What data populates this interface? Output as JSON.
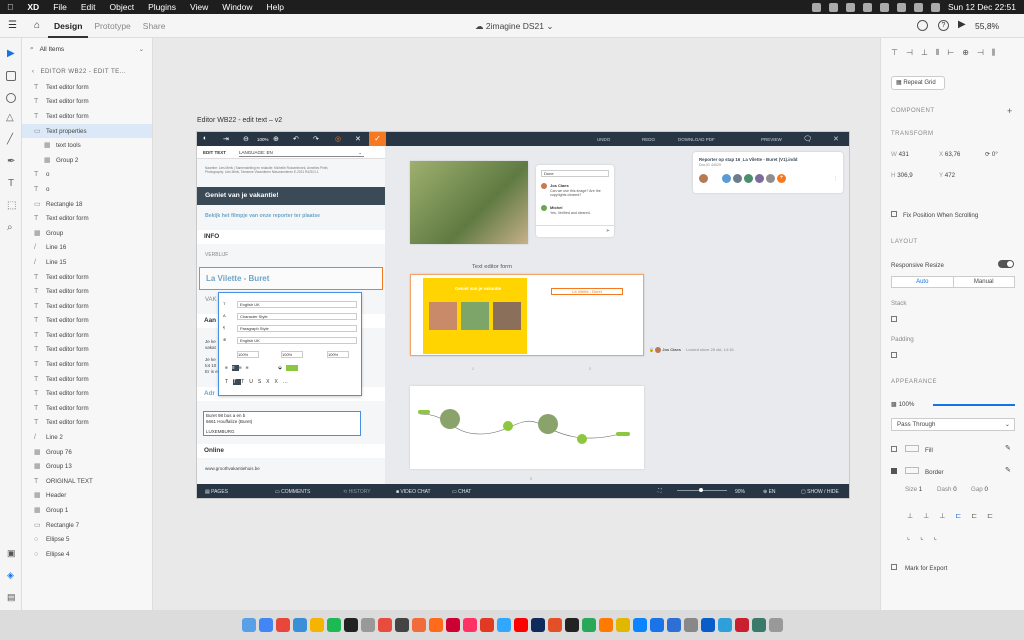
{
  "menubar": {
    "apple": "",
    "app": "XD",
    "items": [
      "File",
      "Edit",
      "Object",
      "Plugins",
      "View",
      "Window",
      "Help"
    ],
    "datetime": "Sun 12 Dec  22:51"
  },
  "xdbar": {
    "tabs": [
      "Design",
      "Prototype",
      "Share"
    ],
    "doc_title": "2imagine DS21",
    "zoom": "55,8%"
  },
  "layers": {
    "filter": "All Items",
    "back_label": "EDITOR WB22 - EDIT TE...",
    "rows": [
      {
        "l": "Text editor form",
        "ic": "T"
      },
      {
        "l": "Text editor form",
        "ic": "T"
      },
      {
        "l": "Text editor form",
        "ic": "T"
      },
      {
        "l": "Text properties",
        "ic": "▭",
        "sel": true
      },
      {
        "l": "text tools",
        "ic": "▦",
        "ind": true
      },
      {
        "l": "Group 2",
        "ic": "▦",
        "ind": true
      },
      {
        "l": "o",
        "ic": "T"
      },
      {
        "l": "o",
        "ic": "T"
      },
      {
        "l": "Rectangle 18",
        "ic": "▭"
      },
      {
        "l": "Text editor form",
        "ic": "T"
      },
      {
        "l": "Group",
        "ic": "▦"
      },
      {
        "l": "Line 16",
        "ic": "/"
      },
      {
        "l": "Line 15",
        "ic": "/"
      },
      {
        "l": "Text editor form",
        "ic": "T"
      },
      {
        "l": "Text editor form",
        "ic": "T"
      },
      {
        "l": "Text editor form",
        "ic": "T"
      },
      {
        "l": "Text editor form",
        "ic": "T"
      },
      {
        "l": "Text editor form",
        "ic": "T"
      },
      {
        "l": "Text editor form",
        "ic": "T"
      },
      {
        "l": "Text editor form",
        "ic": "T"
      },
      {
        "l": "Text editor form",
        "ic": "T"
      },
      {
        "l": "Text editor form",
        "ic": "T"
      },
      {
        "l": "Text editor form",
        "ic": "T"
      },
      {
        "l": "Text editor form",
        "ic": "T"
      },
      {
        "l": "Line 2",
        "ic": "/"
      },
      {
        "l": "Group 76",
        "ic": "▦"
      },
      {
        "l": "Group 13",
        "ic": "▦"
      },
      {
        "l": "ORIGINAL TEXT",
        "ic": "T"
      },
      {
        "l": "Header",
        "ic": "▦"
      },
      {
        "l": "Group 1",
        "ic": "▦"
      },
      {
        "l": "Rectangle 7",
        "ic": "▭"
      },
      {
        "l": "Ellipse 5",
        "ic": "○"
      },
      {
        "l": "Ellipse 4",
        "ic": "○"
      }
    ]
  },
  "canvas": {
    "artboard_title": "Editor WB22 - edit text – v2",
    "frame_label": "Text editor form"
  },
  "editor": {
    "top_zoom": "100%",
    "top_btns": [
      "UNDO",
      "REDO",
      "DOWNLOAD PDF",
      "PREVIEW"
    ],
    "edit_text_tab": "EDIT TEXT",
    "language": "LANGUAGE: EN",
    "credits": "Naamhe: Lies Melis | Samenstelling en redactie: Michelle Rossenbroek, Annelies Pirlet, Photography: Lies Melis, Tamsene Vlaanderen Nieuwsenteren E-2021 R425 D-1",
    "heading": "Geniet van je vakantie!",
    "link": "Bekijk het filmpje van onze reporter ter plaatse",
    "s_info": "INFO",
    "s_verblijf": "VERBLIJF",
    "title_edit": "La Vilette - Buret",
    "s_vak": "VAK",
    "s_aan": "Aan",
    "s_adr": "Adr",
    "p1": "Je ke",
    "p2": "vakat",
    "p3": "Je ke",
    "p4": "tot 10",
    "p5": "Er is e",
    "address": [
      "Buret 98 bus a en b",
      "6661 Houffalize (Buret)",
      "",
      "LUXEMBURG"
    ],
    "s_online": "Online",
    "url": "www.groothvakantiehuis.be",
    "bottom": [
      "PAGES",
      "COMMENTS",
      "HISTORY",
      "VIDEO CHAT",
      "CHAT",
      "EN",
      "SHOW / HIDE"
    ],
    "bot_zoom": "90%",
    "tp": {
      "lang": "English UK",
      "char": "Character Style",
      "para": "Paragraph Style",
      "lang2": "English UK",
      "v1": "100%",
      "v2": "100%",
      "v3": "100%"
    },
    "comment": {
      "status": "Done",
      "user": "Jos Claes",
      "msg": "Can we use this image? Are the copyrights cleared?",
      "user2": "Michel",
      "msg2": "Yes, Verified and cleared."
    },
    "doc": {
      "title": "Reporter op stap 16_La Vilette - Buret (V1).indd",
      "id": "Doc ID 44029"
    },
    "spread2": {
      "page_title": "La Vilette - Buret",
      "cover": "Geniet van je vakantie",
      "locked": "Locked since 25 okt, 14:16",
      "user": "Jos Claes"
    },
    "page_nums": [
      "1",
      "2",
      "3",
      "4",
      "5"
    ]
  },
  "rpanel": {
    "repeat_grid": "Repeat Grid",
    "component": "COMPONENT",
    "transform": "TRANSFORM",
    "w": "431",
    "x": "63,76",
    "rot": "0°",
    "h": "306,9",
    "y": "472",
    "fix": "Fix Position When Scrolling",
    "layout": "LAYOUT",
    "responsive": "Responsive Resize",
    "auto": "Auto",
    "manual": "Manual",
    "stack": "Stack",
    "padding": "Padding",
    "appearance": "APPEARANCE",
    "opacity": "100%",
    "blend": "Pass Through",
    "fill": "Fill",
    "border": "Border",
    "size_l": "Size",
    "size_v": "1",
    "dash_l": "Dash",
    "dash_v": "0",
    "gap_l": "Gap",
    "gap_v": "0",
    "export": "Mark for Export"
  },
  "colors": {
    "accent": "#1473e6",
    "editor_dark": "#273544",
    "orange": "#f47920",
    "green": "#8dc63f",
    "heading_bg": "#3b4a57",
    "link": "#6fa5c9"
  }
}
